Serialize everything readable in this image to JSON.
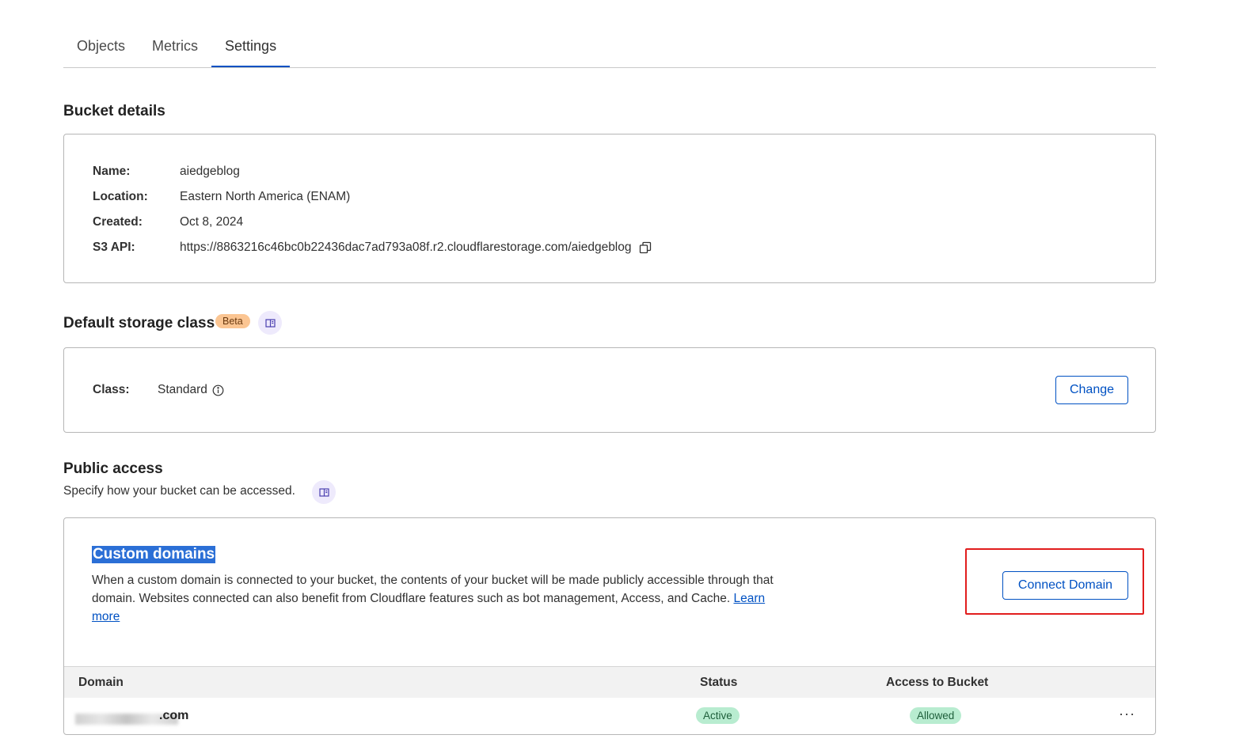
{
  "tabs": [
    {
      "label": "Objects"
    },
    {
      "label": "Metrics"
    },
    {
      "label": "Settings"
    }
  ],
  "bucket_details": {
    "title": "Bucket details",
    "name_label": "Name:",
    "name_value": "aiedgeblog",
    "location_label": "Location:",
    "location_value": "Eastern North America (ENAM)",
    "created_label": "Created:",
    "created_value": "Oct 8, 2024",
    "s3_label": "S3 API:",
    "s3_value": "https://8863216c46bc0b22436dac7ad793a08f.r2.cloudflarestorage.com/aiedgeblog"
  },
  "storage_class": {
    "title": "Default storage class",
    "badge": "Beta",
    "class_label": "Class:",
    "class_value": "Standard",
    "change_button": "Change"
  },
  "public_access": {
    "title": "Public access",
    "subtitle": "Specify how your bucket can be accessed.",
    "custom_domains": {
      "title": "Custom domains",
      "description": "When a custom domain is connected to your bucket, the contents of your bucket will be made publicly accessible through that domain. Websites connected can also benefit from Cloudflare features such as bot management, Access, and Cache.",
      "learn_more": "Learn more",
      "connect_button": "Connect Domain",
      "columns": {
        "domain": "Domain",
        "status": "Status",
        "access": "Access to Bucket"
      },
      "rows": [
        {
          "domain": ".com",
          "status": "Active",
          "access": "Allowed",
          "more": "···"
        }
      ]
    }
  },
  "colors": {
    "accent": "#0051c3",
    "beta_badge": "#fbc592",
    "status_pill": "#b8ecd0",
    "highlight_box": "#e11d1d"
  }
}
